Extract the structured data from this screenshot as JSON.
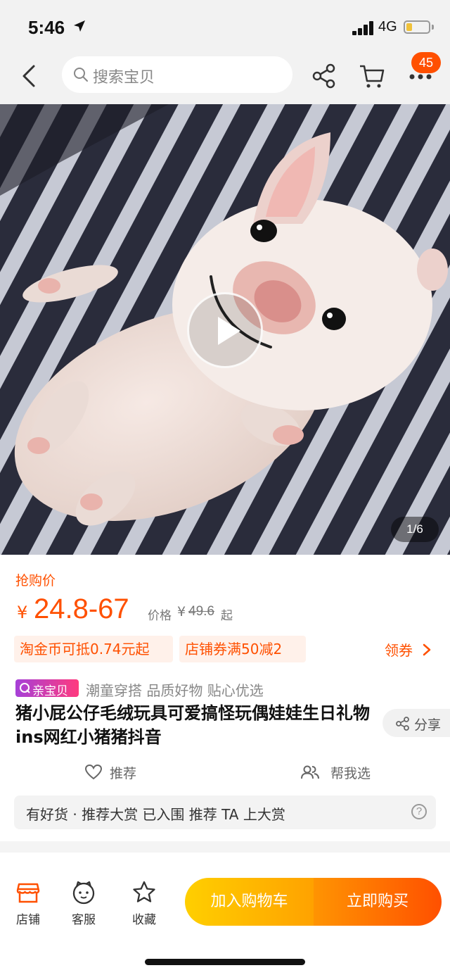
{
  "status_bar": {
    "time": "5:46",
    "network": "4G"
  },
  "nav": {
    "search_placeholder": "搜索宝贝",
    "cart_badge": "45"
  },
  "media": {
    "page_indicator": "1/6"
  },
  "price": {
    "label": "抢购价",
    "currency": "¥",
    "value": "24.8-67",
    "original_label": "价格",
    "original_currency": "¥",
    "original_value": "49.6",
    "original_suffix": "起"
  },
  "promos": [
    {
      "text": "淘金币可抵0.74元起"
    },
    {
      "text": "店铺券满50减2"
    }
  ],
  "coupon_link": "领券",
  "badge": {
    "text": "亲宝贝"
  },
  "tagline": "潮童穿搭 品质好物 贴心优选",
  "title": "猪小屁公仔毛绒玩具可爱搞怪玩偶娃娃生日礼物ins网红小猪猪抖音",
  "share_label": "分享",
  "actions": {
    "recommend": "推荐",
    "help_choose": "帮我选"
  },
  "award_bar": {
    "text": "有好货 · 推荐大赏 已入围 推荐 TA 上大赏",
    "help": "?"
  },
  "bottom_bar": {
    "tabs": [
      {
        "label": "店铺",
        "icon": "store-icon"
      },
      {
        "label": "客服",
        "icon": "customer-service-icon"
      },
      {
        "label": "收藏",
        "icon": "star-icon"
      }
    ],
    "add_to_cart": "加入购物车",
    "buy_now": "立即购买"
  },
  "colors": {
    "accent": "#ff5000",
    "cart_gradient_start": "#ffcf00",
    "buy_gradient_end": "#ff5000"
  }
}
